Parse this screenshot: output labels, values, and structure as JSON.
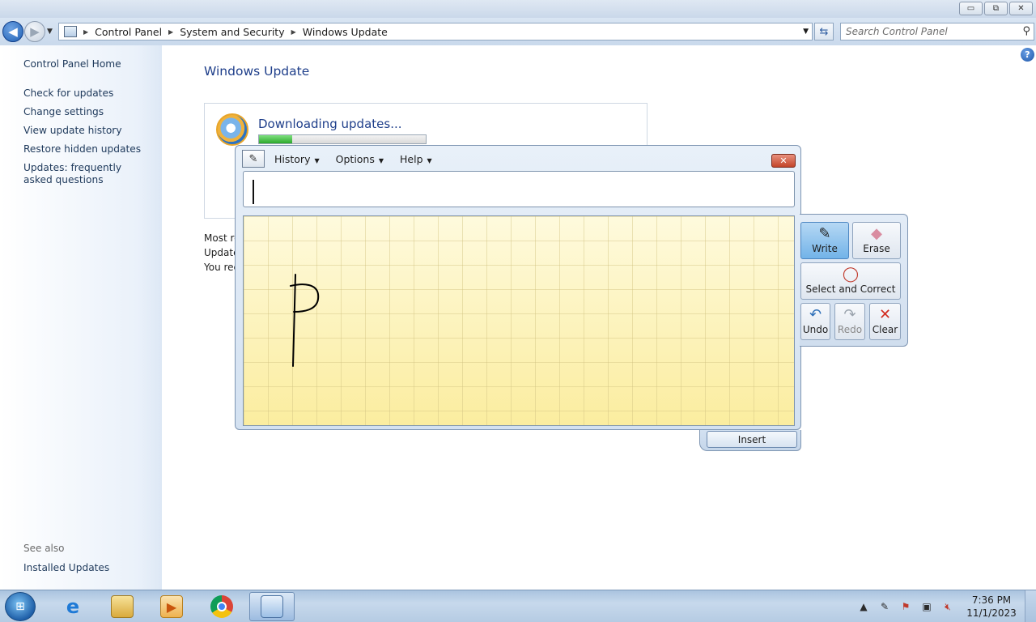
{
  "window": {
    "controls": {
      "minimize": "▭",
      "maximize": "⧉",
      "close": "✕"
    }
  },
  "address_bar": {
    "root_icon": "control-panel-icon",
    "crumbs": [
      "Control Panel",
      "System and Security",
      "Windows Update"
    ],
    "search_placeholder": "Search Control Panel"
  },
  "sidebar": {
    "home": "Control Panel Home",
    "links": [
      "Check for updates",
      "Change settings",
      "View update history",
      "Restore hidden updates",
      "Updates: frequently asked questions"
    ],
    "see_also_label": "See also",
    "see_also_links": [
      "Installed Updates"
    ]
  },
  "main": {
    "title": "Windows Update",
    "status": "Downloading updates...",
    "progress": 0.2,
    "info_lines": [
      "Most re",
      "Update",
      "You rec"
    ]
  },
  "math_input_panel": {
    "menus": [
      "History",
      "Options",
      "Help"
    ],
    "insert_label": "Insert",
    "tools": {
      "write": "Write",
      "erase": "Erase",
      "select_correct": "Select and Correct",
      "undo": "Undo",
      "redo": "Redo",
      "clear": "Clear"
    },
    "active_tool": "write"
  },
  "taskbar": {
    "apps": [
      "internet-explorer",
      "windows-explorer",
      "media-player",
      "chrome",
      "control-panel"
    ],
    "active_app": "control-panel",
    "clock_time": "7:36 PM",
    "clock_date": "11/1/2023"
  },
  "colors": {
    "link": "#1e395b",
    "title": "#1e3e8a",
    "progress": "#2ca82c",
    "canvas": "#fdf4c0"
  }
}
